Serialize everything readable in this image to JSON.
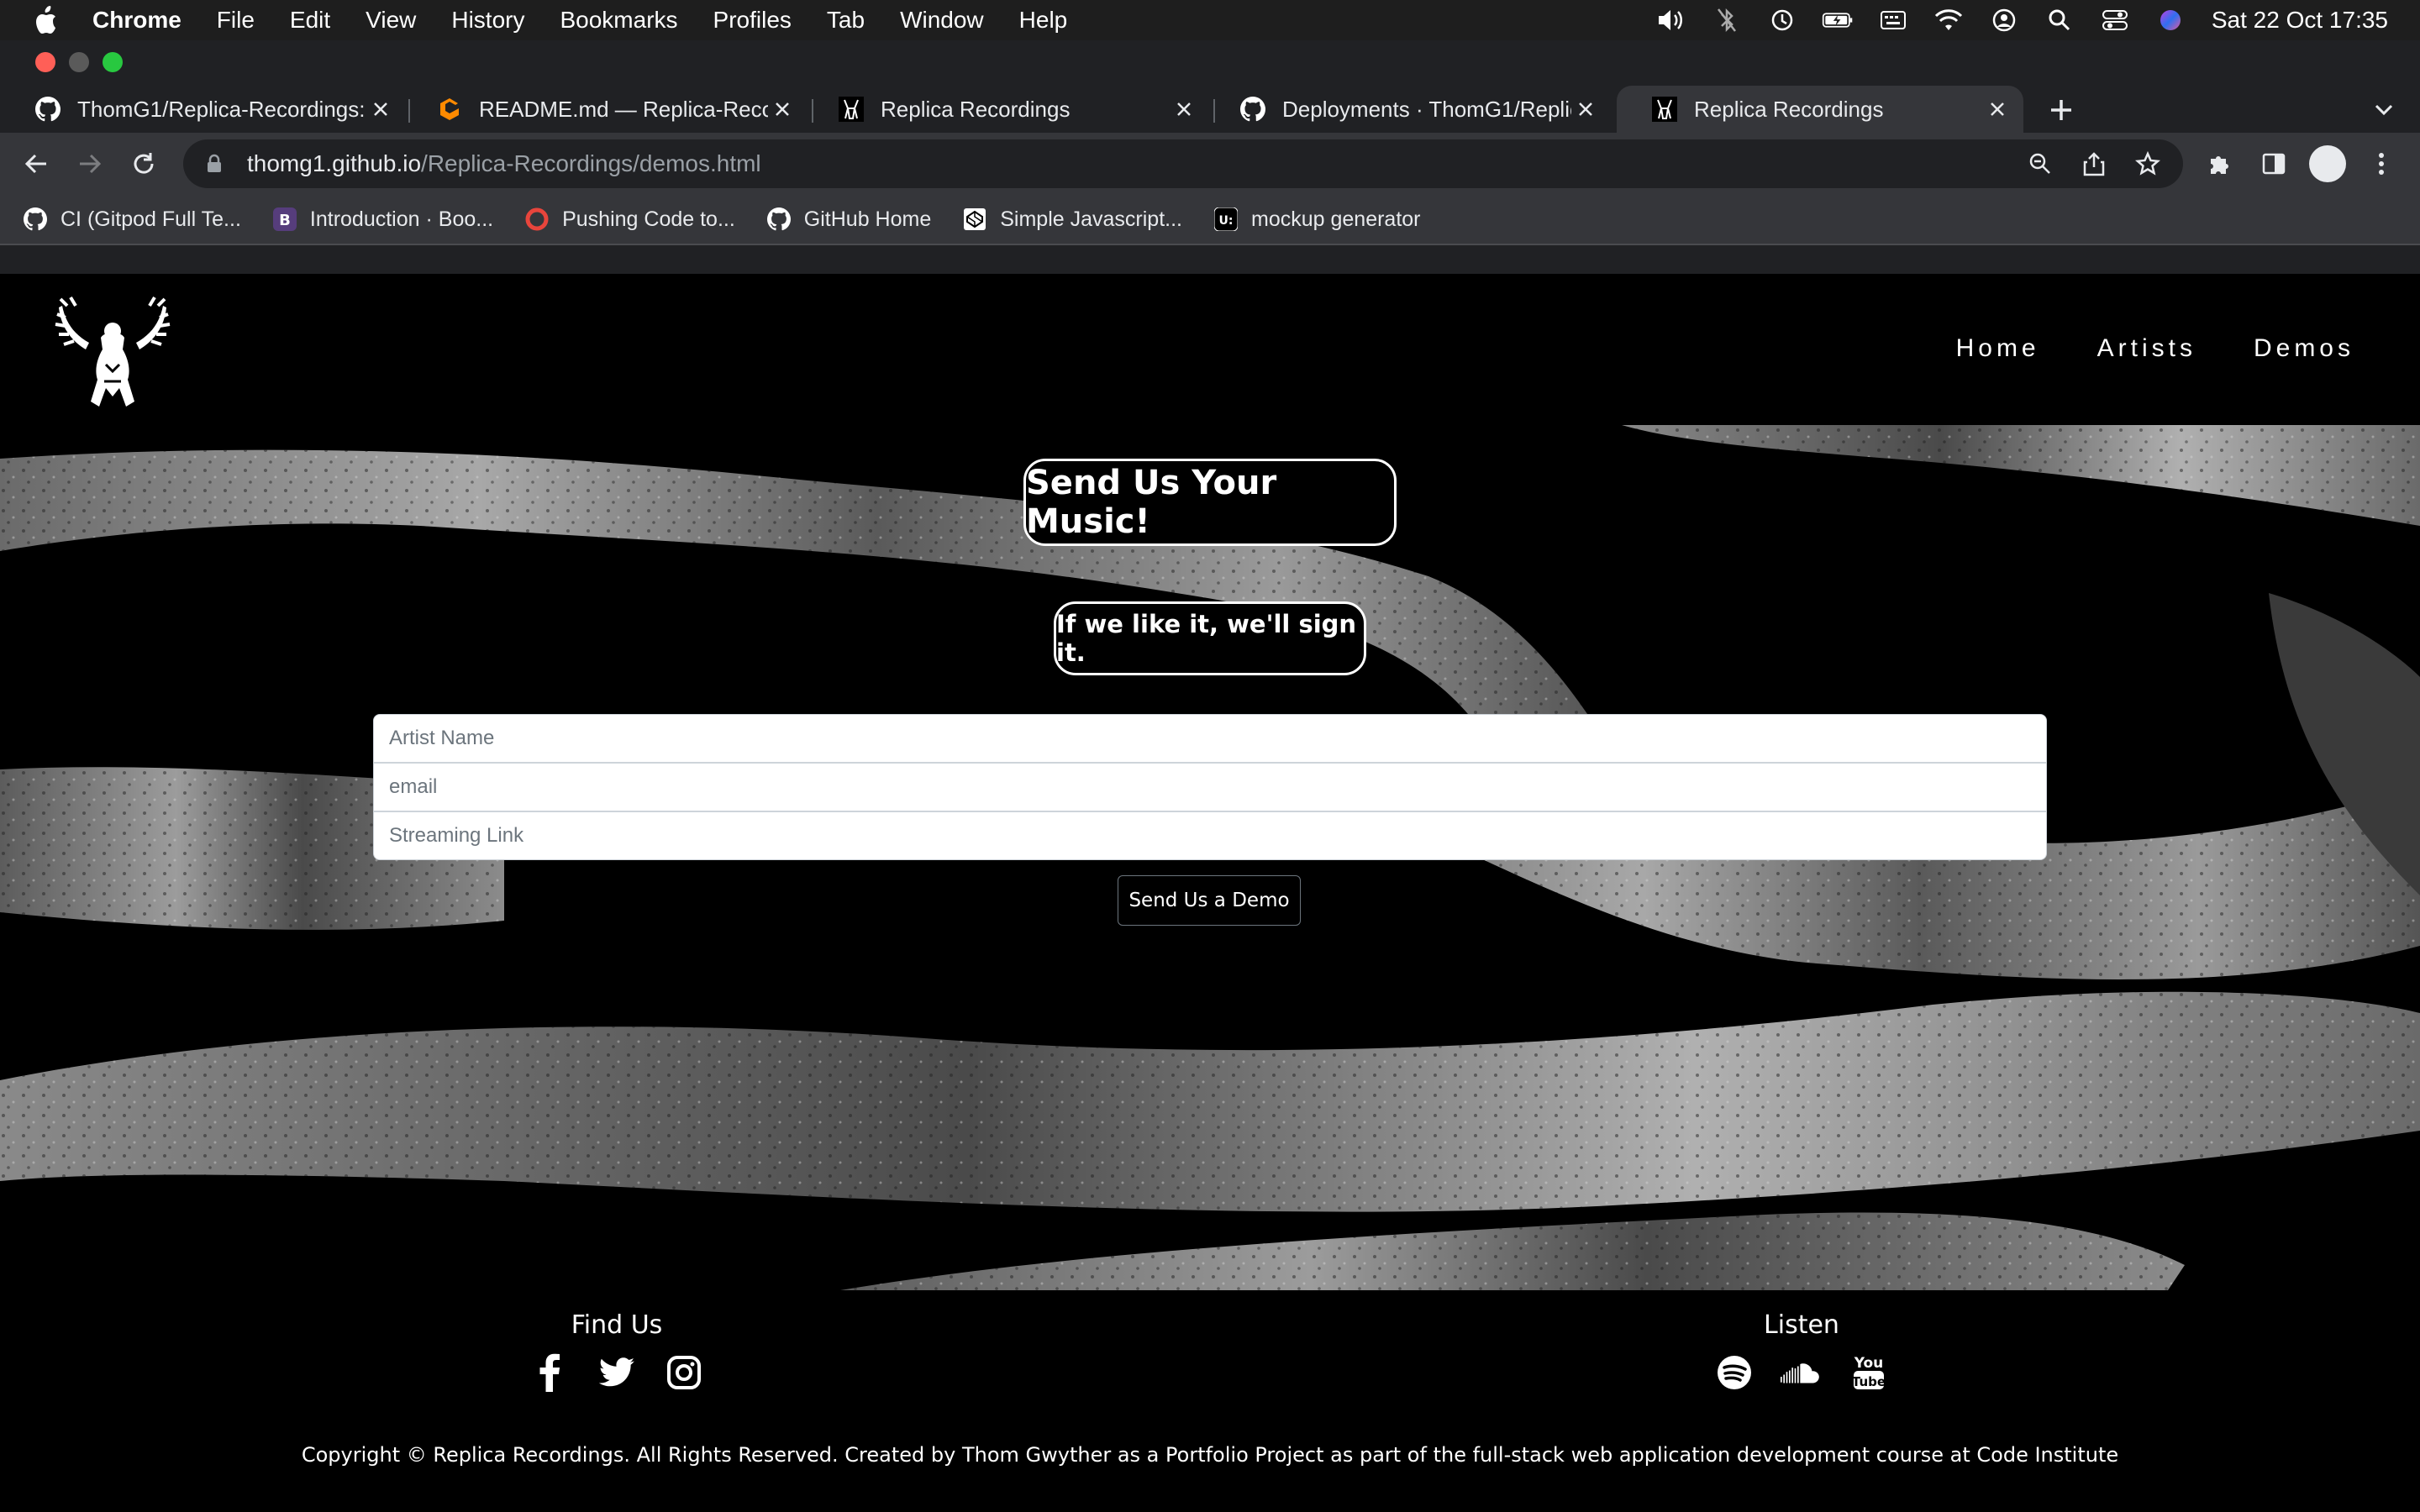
{
  "menubar": {
    "app": "Chrome",
    "items": [
      "File",
      "Edit",
      "View",
      "History",
      "Bookmarks",
      "Profiles",
      "Tab",
      "Window",
      "Help"
    ],
    "clock": "Sat 22 Oct  17:35"
  },
  "tabs": [
    {
      "label": "ThomG1/Replica-Recordings: A",
      "icon": "github-icon"
    },
    {
      "label": "README.md — Replica-Record",
      "icon": "gitpod-icon"
    },
    {
      "label": "Replica Recordings",
      "icon": "site-logo-icon"
    },
    {
      "label": "Deployments · ThomG1/Replica",
      "icon": "github-icon"
    },
    {
      "label": "Replica Recordings",
      "icon": "site-logo-icon",
      "active": true
    }
  ],
  "address": {
    "host": "thomg1.github.io",
    "path": "/Replica-Recordings/demos.html"
  },
  "bookmarks": [
    {
      "label": "CI (Gitpod Full Te...",
      "icon": "github-icon"
    },
    {
      "label": "Introduction · Boo...",
      "icon": "bootstrap-icon"
    },
    {
      "label": "Pushing Code to...",
      "icon": "circle-icon"
    },
    {
      "label": "GitHub Home",
      "icon": "github-icon"
    },
    {
      "label": "Simple Javascript...",
      "icon": "codepen-icon"
    },
    {
      "label": "mockup generator",
      "icon": "uizard-icon"
    }
  ],
  "site": {
    "nav": [
      "Home",
      "Artists",
      "Demos"
    ],
    "heading": "Send Us Your Music!",
    "subheading": "If we like it, we'll sign it.",
    "form": {
      "artist_placeholder": "Artist Name",
      "email_placeholder": "email",
      "link_placeholder": "Streaming Link",
      "submit_label": "Send Us a Demo"
    },
    "footer": {
      "find_us": "Find Us",
      "listen": "Listen",
      "social_icons": [
        "facebook-icon",
        "twitter-icon",
        "instagram-icon"
      ],
      "listen_icons": [
        "spotify-icon",
        "soundcloud-icon",
        "youtube-icon"
      ],
      "copyright": "Copyright © Replica Recordings. All Rights Reserved. Created by Thom Gwyther as a Portfolio Project as part of the full-stack web application development course at Code Institute"
    }
  },
  "colors": {
    "page_bg": "#000000",
    "chrome_tabstrip": "#202124",
    "chrome_toolbar": "#35363a",
    "close": "#ff5f57",
    "minimize": "#5a5a5a",
    "zoom": "#28c840"
  }
}
